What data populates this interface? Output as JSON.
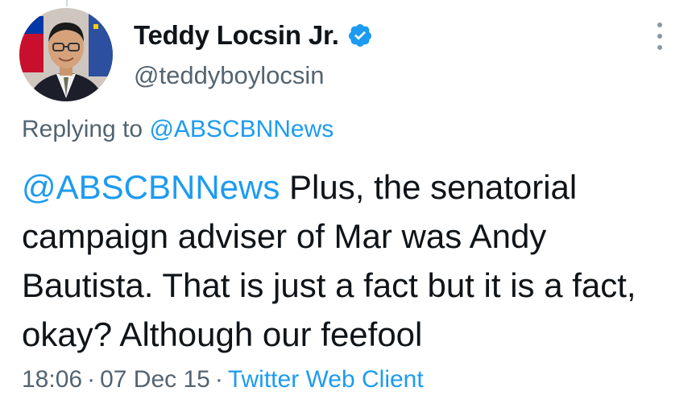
{
  "author": {
    "display_name": "Teddy Locsin Jr.",
    "handle": "@teddyboylocsin",
    "verified": true,
    "verified_color": "#1d9bf0"
  },
  "reply": {
    "prefix": "Replying to",
    "mention": "@ABSCBNNews"
  },
  "tweet": {
    "mention": "@ABSCBNNews",
    "text": " Plus, the senatorial campaign adviser of Mar was Andy Bautista. That is just a fact but it is a fact, okay? Although our feefool"
  },
  "meta": {
    "time": "18:06",
    "separator": "·",
    "date": "07 Dec 15",
    "source": "Twitter Web Client"
  },
  "icons": {
    "menu": "more-vertical-icon",
    "badge": "verified-badge-icon"
  },
  "colors": {
    "link": "#1d9bf0",
    "secondary_text": "#536471",
    "primary_text": "#0f1419"
  }
}
